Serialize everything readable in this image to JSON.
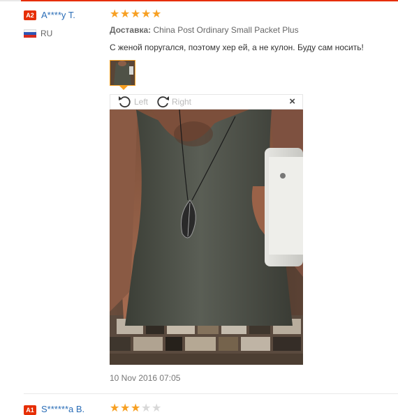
{
  "reviews": [
    {
      "badge": "A2",
      "user": "A****y T.",
      "country": "RU",
      "rating": 5,
      "shipping_label": "Доставка:",
      "shipping_method": "China Post Ordinary Small Packet Plus",
      "text": "С женой поругался, поэтому хер ей, а не кулон. Буду сам носить!",
      "date": "10 Nov 2016 07:05"
    },
    {
      "badge": "A1",
      "user": "S******a B.",
      "rating": 3
    }
  ],
  "viewer": {
    "rotate_left_label": "Left",
    "rotate_right_label": "Right",
    "close_label": "×"
  },
  "colors": {
    "accent": "#e62e04",
    "star": "#f7a023",
    "link": "#2a6db7"
  }
}
